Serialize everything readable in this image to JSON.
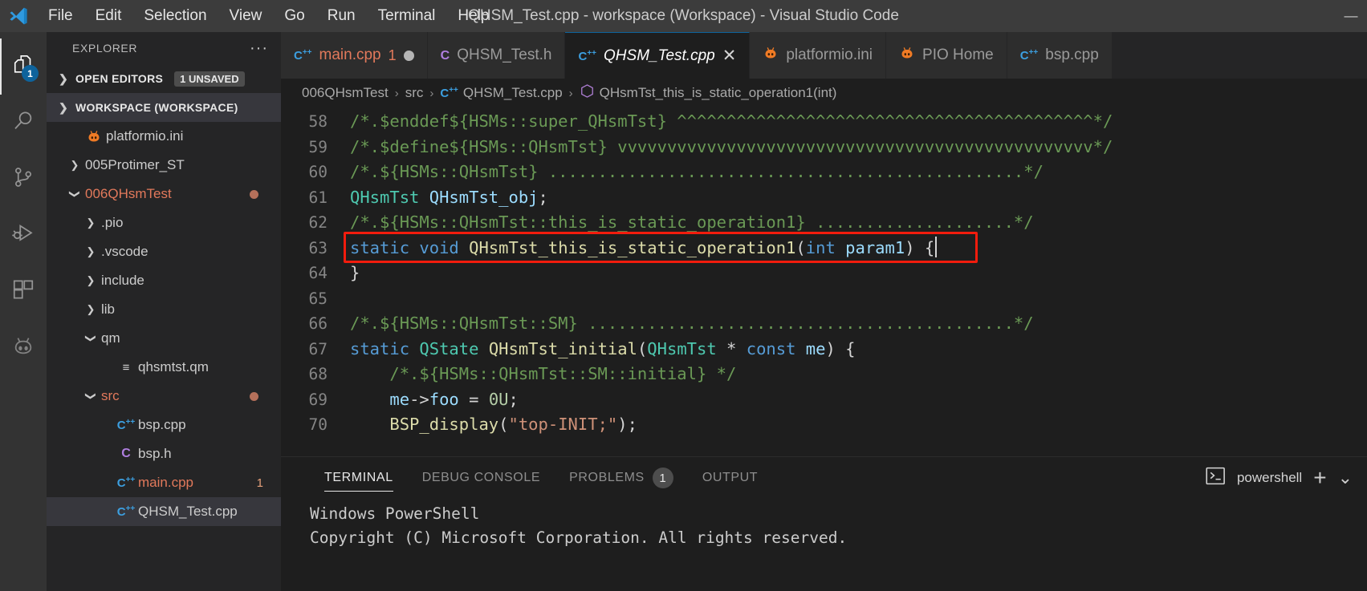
{
  "window": {
    "title": "QHSM_Test.cpp - workspace (Workspace) - Visual Studio Code",
    "minimize_label": "—"
  },
  "menu": {
    "items": [
      {
        "label": "File"
      },
      {
        "label": "Edit"
      },
      {
        "label": "Selection"
      },
      {
        "label": "View"
      },
      {
        "label": "Go"
      },
      {
        "label": "Run"
      },
      {
        "label": "Terminal"
      },
      {
        "label": "Help"
      }
    ]
  },
  "activitybar": {
    "items": [
      {
        "name": "explorer",
        "icon": "files-icon",
        "badge": "1",
        "active": true
      },
      {
        "name": "search",
        "icon": "search-icon",
        "badge": "",
        "active": false
      },
      {
        "name": "source-control",
        "icon": "source-control-icon",
        "badge": "",
        "active": false
      },
      {
        "name": "run-and-debug",
        "icon": "run-debug-icon",
        "badge": "",
        "active": false
      },
      {
        "name": "extensions",
        "icon": "extensions-icon",
        "badge": "",
        "active": false
      },
      {
        "name": "platformio",
        "icon": "platformio-alien-icon",
        "badge": "",
        "active": false
      }
    ]
  },
  "sidebar": {
    "title": "EXPLORER",
    "more_actions": "···",
    "open_editors": {
      "label": "OPEN EDITORS",
      "badge": "1 UNSAVED",
      "expanded": false
    },
    "workspace": {
      "label": "WORKSPACE (WORKSPACE)",
      "expanded": true
    },
    "tree": [
      {
        "label": "platformio.ini",
        "icon": "platformio-alien-icon",
        "indent": 1,
        "twist": "",
        "modified": false,
        "dirty": false,
        "selected": false,
        "errors": ""
      },
      {
        "label": "005Protimer_ST",
        "icon": "folder",
        "indent": 1,
        "twist": "collapsed",
        "modified": false,
        "dirty": false,
        "selected": false,
        "errors": ""
      },
      {
        "label": "006QHsmTest",
        "icon": "folder",
        "indent": 1,
        "twist": "expanded",
        "modified": true,
        "dirty": true,
        "selected": false,
        "errors": ""
      },
      {
        "label": ".pio",
        "icon": "folder",
        "indent": 2,
        "twist": "collapsed",
        "modified": false,
        "dirty": false,
        "selected": false,
        "errors": ""
      },
      {
        "label": ".vscode",
        "icon": "folder",
        "indent": 2,
        "twist": "collapsed",
        "modified": false,
        "dirty": false,
        "selected": false,
        "errors": ""
      },
      {
        "label": "include",
        "icon": "folder",
        "indent": 2,
        "twist": "collapsed",
        "modified": false,
        "dirty": false,
        "selected": false,
        "errors": ""
      },
      {
        "label": "lib",
        "icon": "folder",
        "indent": 2,
        "twist": "collapsed",
        "modified": false,
        "dirty": false,
        "selected": false,
        "errors": ""
      },
      {
        "label": "qm",
        "icon": "folder",
        "indent": 2,
        "twist": "expanded",
        "modified": false,
        "dirty": false,
        "selected": false,
        "errors": ""
      },
      {
        "label": "qhsmtst.qm",
        "icon": "qm-file-icon",
        "indent": 3,
        "twist": "",
        "modified": false,
        "dirty": false,
        "selected": false,
        "errors": ""
      },
      {
        "label": "src",
        "icon": "folder",
        "indent": 2,
        "twist": "expanded",
        "modified": true,
        "dirty": true,
        "selected": false,
        "errors": ""
      },
      {
        "label": "bsp.cpp",
        "icon": "cpp-file-icon",
        "indent": 3,
        "twist": "",
        "modified": false,
        "dirty": false,
        "selected": false,
        "errors": ""
      },
      {
        "label": "bsp.h",
        "icon": "c-header-file-icon",
        "indent": 3,
        "twist": "",
        "modified": false,
        "dirty": false,
        "selected": false,
        "errors": ""
      },
      {
        "label": "main.cpp",
        "icon": "cpp-file-icon",
        "indent": 3,
        "twist": "",
        "modified": true,
        "dirty": false,
        "selected": false,
        "errors": "1"
      },
      {
        "label": "QHSM_Test.cpp",
        "icon": "cpp-file-icon",
        "indent": 3,
        "twist": "",
        "modified": false,
        "dirty": false,
        "selected": true,
        "errors": ""
      }
    ]
  },
  "tabs": [
    {
      "label": "main.cpp",
      "icon": "cpp-file-icon",
      "errors": "1",
      "dirty": true,
      "active": false,
      "closeable": false
    },
    {
      "label": "QHSM_Test.h",
      "icon": "c-header-file-icon",
      "errors": "",
      "dirty": false,
      "active": false,
      "closeable": false
    },
    {
      "label": "QHSM_Test.cpp",
      "icon": "cpp-file-icon",
      "errors": "",
      "dirty": false,
      "active": true,
      "closeable": true,
      "close_label": "✕"
    },
    {
      "label": "platformio.ini",
      "icon": "platformio-alien-icon",
      "errors": "",
      "dirty": false,
      "active": false,
      "closeable": false
    },
    {
      "label": "PIO Home",
      "icon": "platformio-alien-icon",
      "errors": "",
      "dirty": false,
      "active": false,
      "closeable": false
    },
    {
      "label": "bsp.cpp",
      "icon": "cpp-file-icon",
      "errors": "",
      "dirty": false,
      "active": false,
      "closeable": false
    }
  ],
  "breadcrumb": {
    "separator": "›",
    "items": [
      {
        "label": "006QHsmTest",
        "icon": ""
      },
      {
        "label": "src",
        "icon": ""
      },
      {
        "label": "QHSM_Test.cpp",
        "icon": "cpp-file-icon"
      },
      {
        "label": "QHsmTst_this_is_static_operation1(int)",
        "icon": "method-symbol-icon"
      }
    ]
  },
  "editor": {
    "highlight_line": 63,
    "cursor_line": 63,
    "lines": [
      {
        "num": "58",
        "tokens": [
          {
            "t": "/*.$enddef${HSMs::super_QHsmTst} ^^^^^^^^^^^^^^^^^^^^^^^^^^^^^^^^^^^^^^^^^^*/",
            "c": "cm"
          }
        ]
      },
      {
        "num": "59",
        "tokens": [
          {
            "t": "/*.$define${HSMs::QHsmTst} vvvvvvvvvvvvvvvvvvvvvvvvvvvvvvvvvvvvvvvvvvvvvvvv*/",
            "c": "cm"
          }
        ]
      },
      {
        "num": "60",
        "tokens": [
          {
            "t": "/*.${HSMs::QHsmTst} ................................................*/",
            "c": "cm"
          }
        ]
      },
      {
        "num": "61",
        "tokens": [
          {
            "t": "QHsmTst",
            "c": "ty"
          },
          {
            "t": " ",
            "c": "pn"
          },
          {
            "t": "QHsmTst_obj",
            "c": "vr"
          },
          {
            "t": ";",
            "c": "pn"
          }
        ]
      },
      {
        "num": "62",
        "tokens": [
          {
            "t": "/*.${HSMs::QHsmTst::this_is_static_operation1} ....................*/",
            "c": "cm"
          }
        ]
      },
      {
        "num": "63",
        "tokens": [
          {
            "t": "static",
            "c": "kw"
          },
          {
            "t": " ",
            "c": "pn"
          },
          {
            "t": "void",
            "c": "kw"
          },
          {
            "t": " ",
            "c": "pn"
          },
          {
            "t": "QHsmTst_this_is_static_operation1",
            "c": "fn"
          },
          {
            "t": "(",
            "c": "pn"
          },
          {
            "t": "int",
            "c": "kw"
          },
          {
            "t": " ",
            "c": "pn"
          },
          {
            "t": "param1",
            "c": "vr"
          },
          {
            "t": ") ",
            "c": "pn"
          },
          {
            "t": "{",
            "c": "pn"
          }
        ]
      },
      {
        "num": "64",
        "tokens": [
          {
            "t": "}",
            "c": "pn"
          }
        ]
      },
      {
        "num": "65",
        "tokens": [
          {
            "t": "",
            "c": "pn"
          }
        ]
      },
      {
        "num": "66",
        "tokens": [
          {
            "t": "/*.${HSMs::QHsmTst::SM} ...........................................*/",
            "c": "cm"
          }
        ]
      },
      {
        "num": "67",
        "tokens": [
          {
            "t": "static",
            "c": "kw"
          },
          {
            "t": " ",
            "c": "pn"
          },
          {
            "t": "QState",
            "c": "ty"
          },
          {
            "t": " ",
            "c": "pn"
          },
          {
            "t": "QHsmTst_initial",
            "c": "fn"
          },
          {
            "t": "(",
            "c": "pn"
          },
          {
            "t": "QHsmTst",
            "c": "ty"
          },
          {
            "t": " * ",
            "c": "pn"
          },
          {
            "t": "const",
            "c": "kw"
          },
          {
            "t": " ",
            "c": "pn"
          },
          {
            "t": "me",
            "c": "vr"
          },
          {
            "t": ") ",
            "c": "pn"
          },
          {
            "t": "{",
            "c": "pn"
          }
        ]
      },
      {
        "num": "68",
        "tokens": [
          {
            "t": "    /*.${HSMs::QHsmTst::SM::initial} */",
            "c": "cm"
          }
        ]
      },
      {
        "num": "69",
        "tokens": [
          {
            "t": "    ",
            "c": "pn"
          },
          {
            "t": "me",
            "c": "vr"
          },
          {
            "t": "->",
            "c": "pn"
          },
          {
            "t": "foo",
            "c": "vr"
          },
          {
            "t": " = ",
            "c": "pn"
          },
          {
            "t": "0U",
            "c": "nm"
          },
          {
            "t": ";",
            "c": "pn"
          }
        ]
      },
      {
        "num": "70",
        "tokens": [
          {
            "t": "    ",
            "c": "pn"
          },
          {
            "t": "BSP_display",
            "c": "fn"
          },
          {
            "t": "(",
            "c": "pn"
          },
          {
            "t": "\"top-INIT;\"",
            "c": "st"
          },
          {
            "t": ");",
            "c": "pn"
          }
        ]
      }
    ]
  },
  "panel": {
    "tabs": [
      {
        "label": "TERMINAL",
        "badge": "",
        "active": true
      },
      {
        "label": "DEBUG CONSOLE",
        "badge": "",
        "active": false
      },
      {
        "label": "PROBLEMS",
        "badge": "1",
        "active": false
      },
      {
        "label": "OUTPUT",
        "badge": "",
        "active": false
      }
    ],
    "terminal_name": "powershell",
    "terminal_icon": "terminal-powershell-icon",
    "new_terminal_label": "+",
    "split_chevron_label": "⌄",
    "output_lines": [
      "Windows PowerShell",
      "Copyright (C) Microsoft Corporation. All rights reserved."
    ]
  },
  "colors": {
    "accent": "#0e639c",
    "error": "#e2795b",
    "highlight_box": "#f21c0d",
    "comment": "#6a9955",
    "keyword": "#569cd6",
    "type": "#4ec9b0",
    "function": "#dcdcaa",
    "string": "#ce9178"
  }
}
